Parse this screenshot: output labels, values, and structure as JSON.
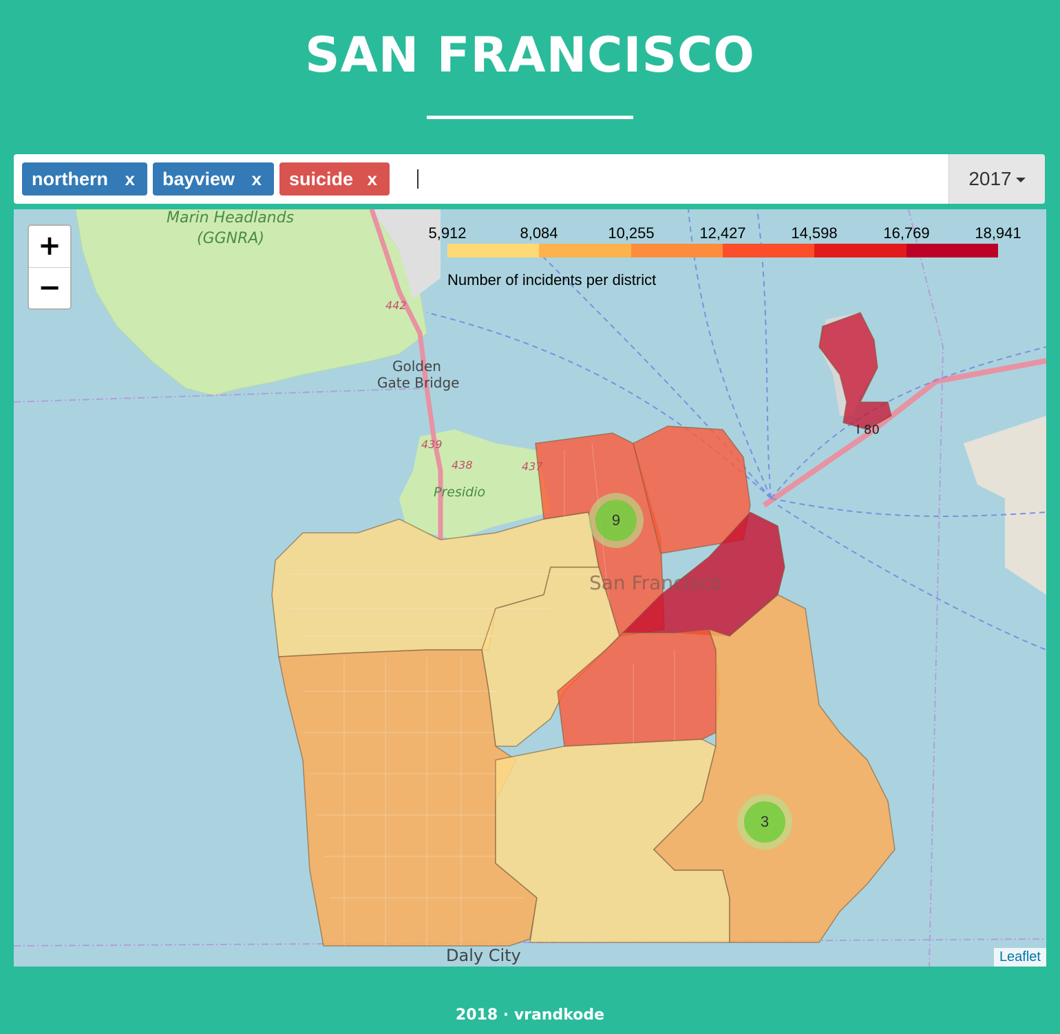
{
  "header": {
    "title": "SAN FRANCISCO"
  },
  "filters": {
    "tags": [
      {
        "label": "northern",
        "remove": "x",
        "color": "#337ab7"
      },
      {
        "label": "bayview",
        "remove": "x",
        "color": "#337ab7"
      },
      {
        "label": "suicide",
        "remove": "x",
        "color": "#d9534f"
      }
    ],
    "input_value": "",
    "year": "2017"
  },
  "map": {
    "zoom_in": "+",
    "zoom_out": "−",
    "attribution": "Leaflet",
    "legend": {
      "title": "Number of incidents per district",
      "ticks": [
        "5,912",
        "8,084",
        "10,255",
        "12,427",
        "14,598",
        "16,769",
        "18,941"
      ],
      "colors": [
        "#fed976",
        "#feb24c",
        "#fd8d3c",
        "#fc4e2a",
        "#e31a1c",
        "#bd0026"
      ]
    },
    "labels": {
      "marin": "Marin Headlands",
      "ggnra": "(GGNRA)",
      "golden": "Golden",
      "gate": "Gate Bridge",
      "presidio": "Presidio",
      "sf": "San Francisco",
      "daly": "Daly City",
      "r442": "442",
      "r439": "439",
      "r438": "438",
      "r437": "437",
      "i80": "I 80"
    },
    "clusters": [
      {
        "count": "9"
      },
      {
        "count": "3"
      }
    ]
  },
  "footer": {
    "text": "2018 · vrandkode"
  }
}
